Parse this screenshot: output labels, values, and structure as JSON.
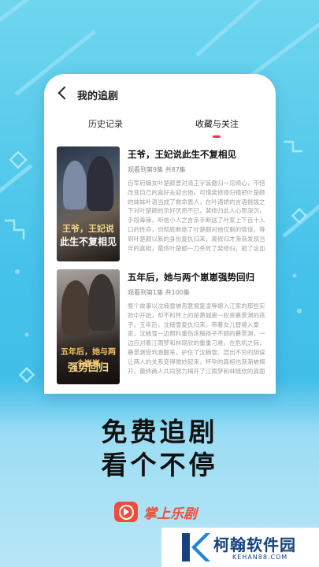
{
  "header": {
    "title": "我的追剧",
    "back_icon": "chevron-left-icon"
  },
  "tabs": [
    {
      "label": "历史记录",
      "active": false
    },
    {
      "label": "收藏与关注",
      "active": true
    }
  ],
  "items": [
    {
      "title": "王爷，王妃说此生不复相见",
      "meta": "观看到第9集 共87集",
      "poster_title_1": "王爷，王妃说",
      "poster_title_2": "此生不复相见",
      "description": "自军府嫡女叶楚颜曾对清王宇装傲归一见倾心，不惜改变自己的喜好去迎合他，可惜裴修修归错把叶楚颜的妹妹叶语当成了救命恩人，在叶语娇的言语挑拨之下对叶楚颜的示好厌恶不已，裴修归此人心思深沉，手段毒辣，听信小人之言亲手断送了叶家上下百十人口的性命，也彻底断绝了叶楚颜对他仅剩的情谊，等到叶楚颜以新的身份复仇归来，裴修归才渐渐发现当年的真相，最终叶楚颜一刀杀死了裴修归，报了这血海深仇。"
    },
    {
      "title": "五年后，她与两个崽崽强势回归",
      "meta": "观看到第1集 共100集",
      "poster_title_1": "五年后，她与两个崽崽",
      "poster_title_2": "强势回归",
      "description": "整个故事以沈楠雪被恶意报复凌辱嫁入江家的那些实验中开始，却不料怀上的是萧城第一权贵慕景渊的孩子，五年后，沈楠雪复仇归来，带着女儿替嫁入豪家，沈楠雪一边照料重伤床榻孩子不顾的慕景渊，一边应对着江雨梦和林晓欣的重重刁难，在危机之际，慕景渊受到激醒来，护住了沈楠雪。层出不穷的阴谋让两人的关系变得微妙起来，怀孕的真相也渐渐被揭开。最终两人共同努力揭开了江雨梦和林晓欣的真面目，让她……"
    }
  ],
  "slogan": {
    "line1": "免费追剧",
    "line2": "看个不停"
  },
  "app": {
    "name": "掌上乐剧",
    "logo_icon": "play-circle-icon",
    "brand_color": "#f24b3b"
  },
  "watermark": {
    "name": "柯翰软件园",
    "url": "KEHAN88.COM",
    "color": "#16437e"
  },
  "colors": {
    "background": "#47c3ea",
    "accent": "#e83a3a"
  }
}
